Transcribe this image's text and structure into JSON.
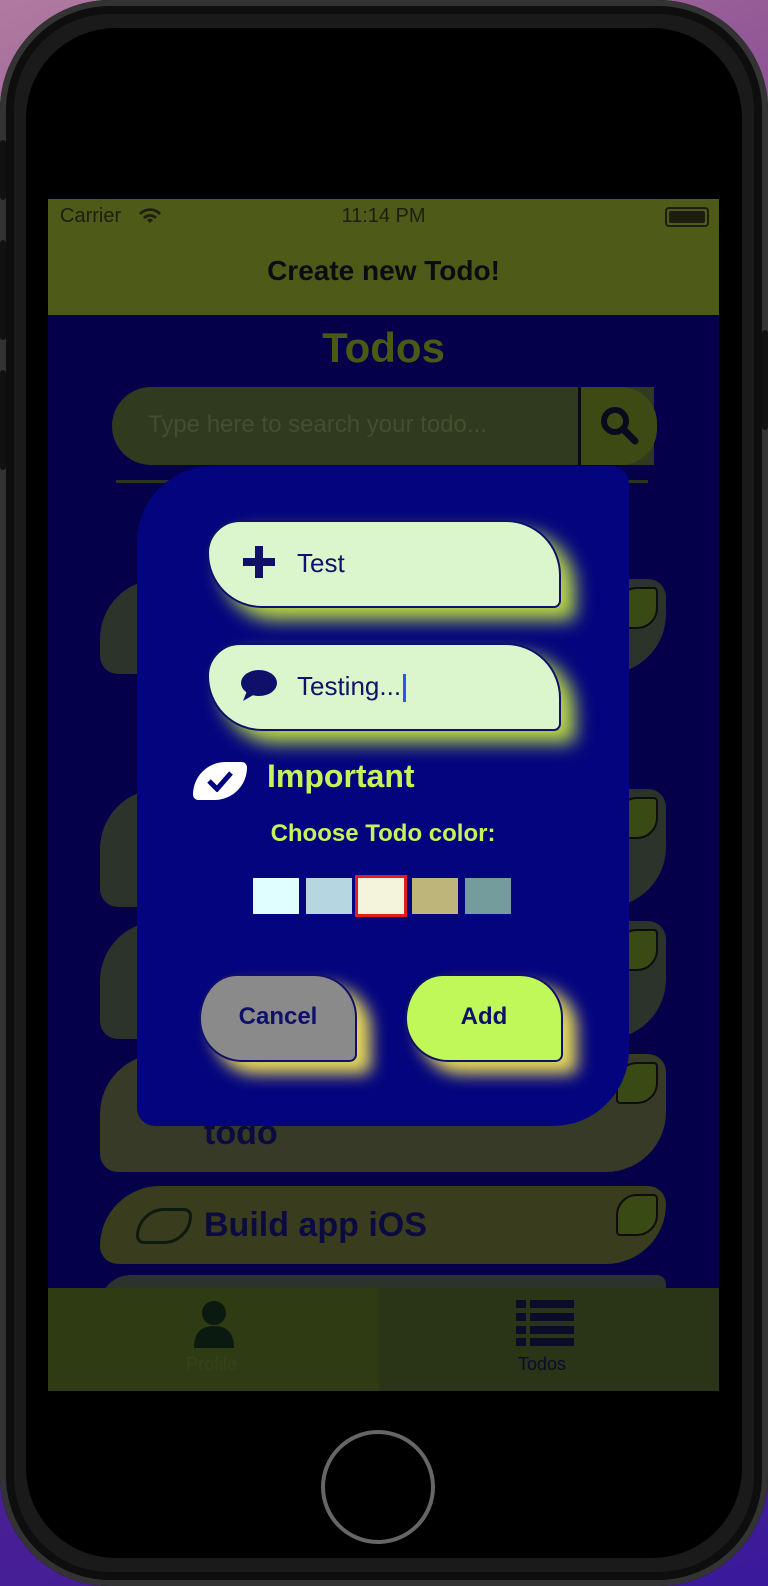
{
  "status_bar": {
    "carrier": "Carrier",
    "time": "11:14 PM"
  },
  "navbar": {
    "title": "Create new Todo!"
  },
  "background": {
    "todos_title": "Todos",
    "search_placeholder": "Type here to search your todo...",
    "cards": [
      {
        "label": "todo"
      },
      {
        "label": "Build app iOS"
      }
    ]
  },
  "tabbar": {
    "tabs": [
      {
        "label": "Profile",
        "icon": "person-icon"
      },
      {
        "label": "Todos",
        "icon": "list-icon"
      }
    ],
    "selected": "Todos"
  },
  "modal": {
    "title_field": {
      "value": "Test",
      "icon": "plus-icon"
    },
    "description_field": {
      "value": "Testing...",
      "icon": "speech-bubble-icon"
    },
    "important": {
      "label": "Important",
      "checked": true
    },
    "color_picker": {
      "label": "Choose Todo color:",
      "colors": [
        "#e0fdff",
        "#b6d7e2",
        "#f4f4dc",
        "#bdb57a",
        "#749c9c"
      ],
      "selected_index": 2,
      "selected_border": "#e02020"
    },
    "cancel_label": "Cancel",
    "add_label": "Add",
    "colors": {
      "cancel_bg": "#8a8a8a",
      "add_bg": "#c0f85a",
      "modal_bg": "#04057e"
    }
  }
}
